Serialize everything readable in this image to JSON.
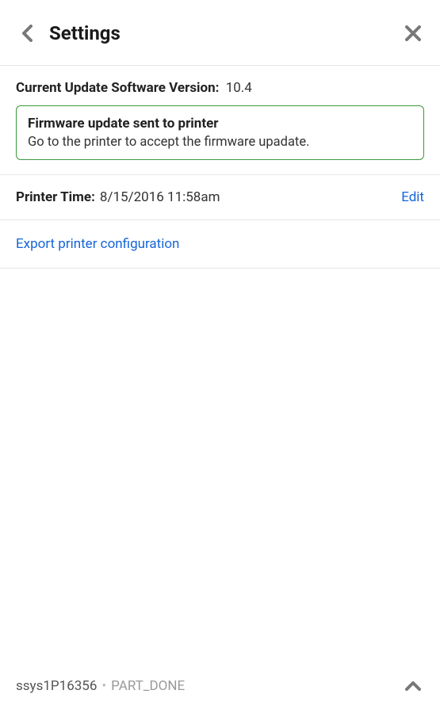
{
  "header": {
    "title": "Settings"
  },
  "version": {
    "label": "Current Update Software Version:",
    "value": "10.4"
  },
  "notice": {
    "title": "Firmware update sent to printer",
    "body": "Go to the printer to accept the firmware upadate."
  },
  "time": {
    "label": "Printer Time:",
    "value": "8/15/2016 11:58am",
    "edit_label": "Edit"
  },
  "export": {
    "label": "Export printer configuration"
  },
  "footer": {
    "device_id": "ssys1P16356",
    "separator": "•",
    "status": "PART_DONE"
  }
}
